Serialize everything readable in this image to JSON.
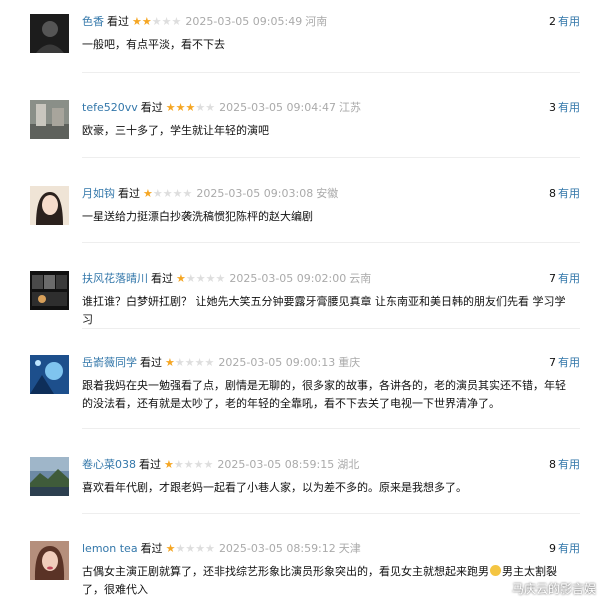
{
  "comments": [
    {
      "author": "色香",
      "seen": "看过",
      "rating": 2,
      "time": "2025-03-05 09:05:49",
      "region": "河南",
      "content": "一般吧，有点平淡，看不下去",
      "votes": "2",
      "votes_label": "有用",
      "avatar_icon": "dark-portrait-avatar"
    },
    {
      "author": "tefe520vv",
      "seen": "看过",
      "rating": 3,
      "time": "2025-03-05 09:04:47",
      "region": "江苏",
      "content": "欧豪，三十多了，学生就让年轻的演吧",
      "votes": "3",
      "votes_label": "有用",
      "avatar_icon": "street-photo-avatar"
    },
    {
      "author": "月如钩",
      "seen": "看过",
      "rating": 1,
      "time": "2025-03-05 09:03:08",
      "region": "安徽",
      "content": "一星送给力挺漂白抄袭洗稿惯犯陈枰的赵大编剧",
      "votes": "8",
      "votes_label": "有用",
      "avatar_icon": "illustrated-girl-avatar"
    },
    {
      "author": "扶风花落晴川",
      "seen": "看过",
      "rating": 1,
      "time": "2025-03-05 09:02:00",
      "region": "云南",
      "content": "谁扛谁？白梦妍扛剧？ 让她先大笑五分钟要露牙膏腰见真章 让东南亚和美日韩的朋友们先看 学习学习",
      "votes": "7",
      "votes_label": "有用",
      "avatar_icon": "film-collage-avatar"
    },
    {
      "author": "岳嵛薇同学",
      "seen": "看过",
      "rating": 1,
      "time": "2025-03-05 09:00:13",
      "region": "重庆",
      "content": "跟着我妈在央一勉强看了点，剧情是无聊的，很多家的故事，各讲各的，老的演员其实还不错，年轻的没法看，还有就是太吵了，老的年轻的全靠吼，看不下去关了电视一下世界清净了。",
      "votes": "7",
      "votes_label": "有用",
      "avatar_icon": "blue-anime-avatar"
    },
    {
      "author": "卷心菜038",
      "seen": "看过",
      "rating": 1,
      "time": "2025-03-05 08:59:15",
      "region": "湖北",
      "content": "喜欢看年代剧，才跟老妈一起看了小巷人家，以为差不多的。原来是我想多了。",
      "votes": "8",
      "votes_label": "有用",
      "avatar_icon": "landscape-avatar"
    },
    {
      "author": "lemon tea",
      "seen": "看过",
      "rating": 1,
      "time": "2025-03-05 08:59:12",
      "region": "天津",
      "content_before": "古偶女主演正剧就算了，还非找综艺形象比演员形象突出的，看见女主就想起来跑男",
      "content_after": "男主太割裂了，很难代入",
      "votes": "9",
      "votes_label": "有用",
      "avatar_icon": "woman-portrait-avatar"
    }
  ],
  "watermark": "马庆云的影言娱",
  "colors": {
    "link": "#3377aa",
    "star_on": "#f5a623",
    "star_off": "#dedede",
    "meta_gray": "#aaaaaa"
  }
}
